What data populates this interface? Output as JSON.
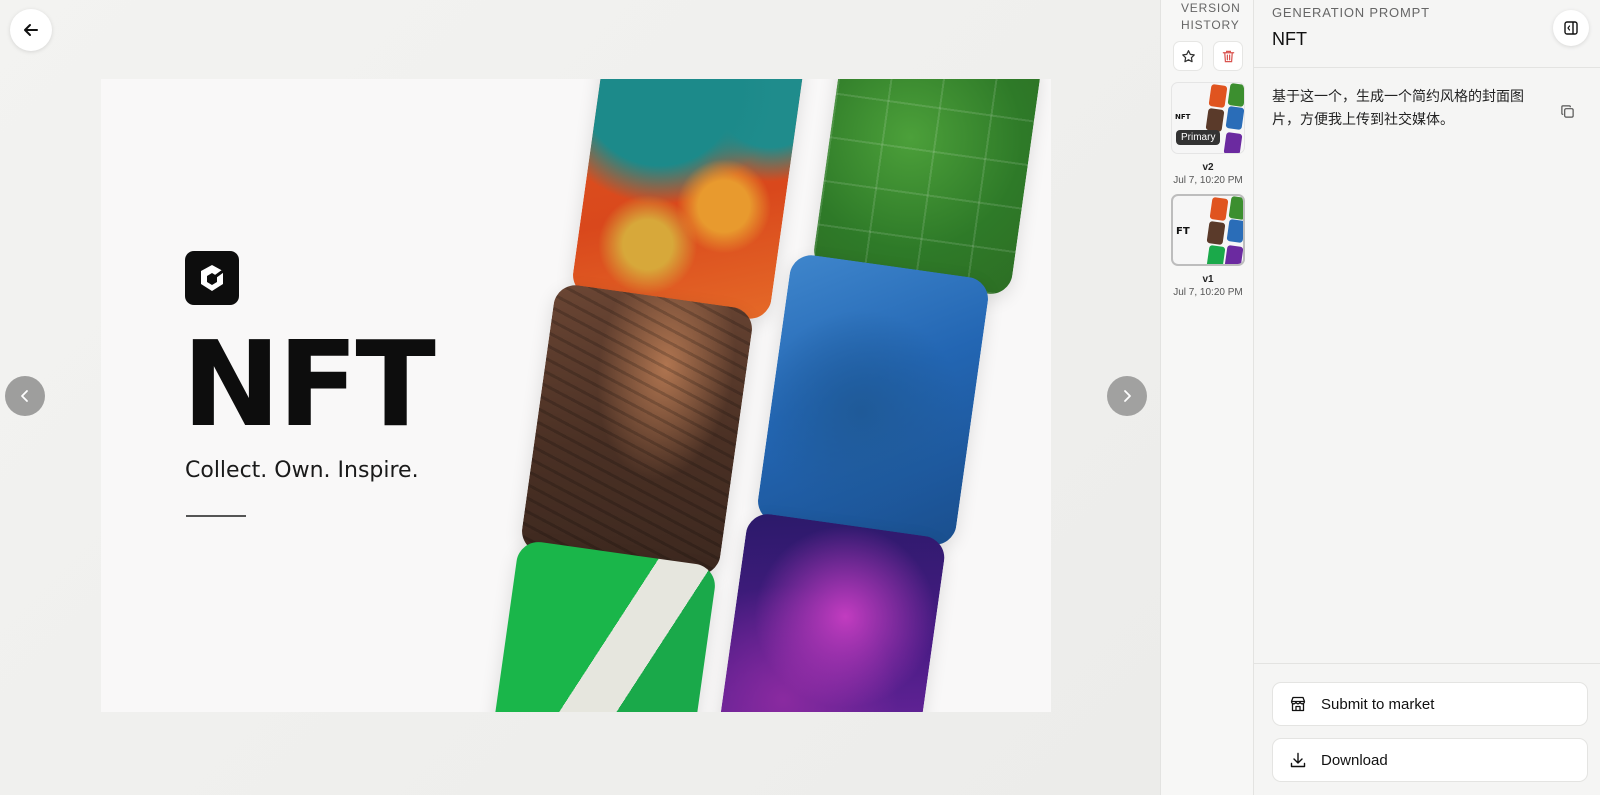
{
  "viewer": {
    "back_icon": "arrow-left-icon",
    "prev_icon": "chevron-left-icon",
    "next_icon": "chevron-right-icon",
    "image": {
      "headline": "NFT",
      "tagline": "Collect. Own. Inspire.",
      "logo_icon": "cube-logo-icon"
    }
  },
  "history": {
    "title": "VERSION HISTORY",
    "star_icon": "star-icon",
    "delete_icon": "trash-icon",
    "versions": [
      {
        "label": "v2",
        "time": "Jul 7, 10:20 PM",
        "badge": "Primary",
        "thumb_text": "NFT"
      },
      {
        "label": "v1",
        "time": "Jul 7, 10:20 PM",
        "badge": "",
        "thumb_text": "FT"
      }
    ]
  },
  "panel": {
    "kicker": "GENERATION PROMPT",
    "title": "NFT",
    "collapse_icon": "panel-collapse-icon",
    "prompt": "基于这一个，生成一个简约风格的封面图片，方便我上传到社交媒体。",
    "copy_icon": "copy-icon",
    "actions": {
      "submit": "Submit to market",
      "download": "Download"
    }
  },
  "colors": {
    "danger": "#d9534f",
    "background": "#efefed"
  }
}
